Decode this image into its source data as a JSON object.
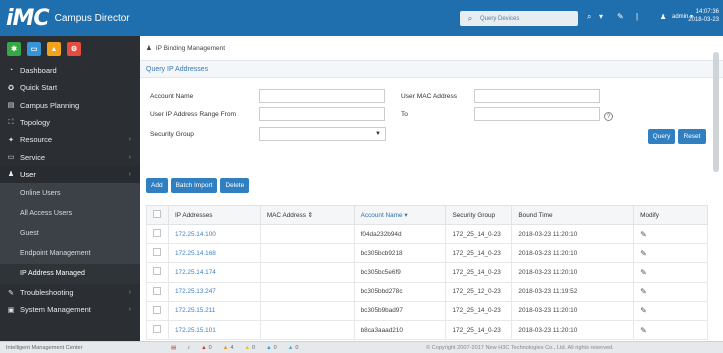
{
  "header": {
    "logo_mark": "iMC",
    "app_name": "Campus Director",
    "search_label": "Query Devices",
    "user": "admin",
    "time": "14:07:36",
    "date": "2018-03-23",
    "icons": [
      "search-icon",
      "bookmark-icon",
      "tools-icon",
      "user-icon"
    ]
  },
  "sidebar": {
    "quick_buttons": [
      {
        "name": "favorite",
        "glyph": "✱",
        "color": "#38a845"
      },
      {
        "name": "monitor",
        "glyph": "▭",
        "color": "#3794d6"
      },
      {
        "name": "alarm",
        "glyph": "▲",
        "color": "#f2a21b"
      },
      {
        "name": "settings",
        "glyph": "⚙",
        "color": "#e24d3f"
      }
    ],
    "items": [
      {
        "label": "Dashboard",
        "icon": "dashboard-icon",
        "glyph": "◔",
        "chevron": false
      },
      {
        "label": "Quick Start",
        "icon": "rocket-icon",
        "glyph": "✪",
        "chevron": false
      },
      {
        "label": "Campus Planning",
        "icon": "planning-icon",
        "glyph": "▤",
        "chevron": false
      },
      {
        "label": "Topology",
        "icon": "topology-icon",
        "glyph": "⛶",
        "chevron": false
      },
      {
        "label": "Resource",
        "icon": "resource-icon",
        "glyph": "✦",
        "chevron": true
      },
      {
        "label": "Service",
        "icon": "service-icon",
        "glyph": "▭",
        "chevron": true
      },
      {
        "label": "User",
        "icon": "user-icon",
        "glyph": "♟",
        "chevron": true
      }
    ],
    "sub_items": [
      {
        "label": "Online Users",
        "selected": false
      },
      {
        "label": "All Access Users",
        "selected": false
      },
      {
        "label": "Guest",
        "selected": false
      },
      {
        "label": "Endpoint Management",
        "selected": false
      },
      {
        "label": "IP Address Managed",
        "selected": true
      }
    ],
    "bottom_items": [
      {
        "label": "Troubleshooting",
        "icon": "wrench-icon",
        "glyph": "✎",
        "chevron": true
      },
      {
        "label": "System Management",
        "icon": "system-icon",
        "glyph": "▣",
        "chevron": true
      }
    ]
  },
  "breadcrumb": "IP Binding Management",
  "panel_title": "Query IP Addresses",
  "form": {
    "account_name_label": "Account Name",
    "account_name_value": "",
    "user_mac_label": "User MAC Address",
    "user_mac_value": "",
    "ip_range_label": "User IP Address Range From",
    "ip_from_value": "",
    "to_label": "To",
    "ip_to_value": "",
    "security_group_label": "Security Group",
    "security_group_value": "",
    "query_label": "Query",
    "reset_label": "Reset"
  },
  "actions": {
    "add_label": "Add",
    "batch_import_label": "Batch Import",
    "delete_label": "Delete"
  },
  "table": {
    "columns": [
      "IP Addresses",
      "MAC Address ⇕",
      "Account Name ▾",
      "Security Group",
      "Bound Time",
      "Modify"
    ],
    "rows": [
      {
        "ip": "172.25.14.100",
        "mac": "",
        "account": "f04da232b94d",
        "group": "172_25_14_0-23",
        "time": "2018-03-23 11:20:10"
      },
      {
        "ip": "172.25.14.168",
        "mac": "",
        "account": "bc305bcb9218",
        "group": "172_25_14_0-23",
        "time": "2018-03-23 11:20:10"
      },
      {
        "ip": "172.25.14.174",
        "mac": "",
        "account": "bc305bc5e6f9",
        "group": "172_25_14_0-23",
        "time": "2018-03-23 11:20:10"
      },
      {
        "ip": "172.25.13.247",
        "mac": "",
        "account": "bc305bbd278c",
        "group": "172_25_12_0-23",
        "time": "2018-03-23 11:19:52"
      },
      {
        "ip": "172.25.15.211",
        "mac": "",
        "account": "bc305b9bad97",
        "group": "172_25_14_0-23",
        "time": "2018-03-23 11:20:10"
      },
      {
        "ip": "172.25.15.101",
        "mac": "",
        "account": "b8ca3aaad210",
        "group": "172_25_14_0-23",
        "time": "2018-03-23 11:20:10"
      }
    ]
  },
  "status": {
    "product": "Intelligent Management Center",
    "alarms": [
      {
        "count": "0",
        "color": "#d32f2f"
      },
      {
        "count": "4",
        "color": "#f28c18"
      },
      {
        "count": "0",
        "color": "#e9c21b"
      },
      {
        "count": "0",
        "color": "#2e9bd6"
      },
      {
        "count": "0",
        "color": "#4aa3d8"
      }
    ],
    "copyright": "© Copyright 2007-2017 New H3C Technologies Co., Ltd. All rights reserved."
  }
}
